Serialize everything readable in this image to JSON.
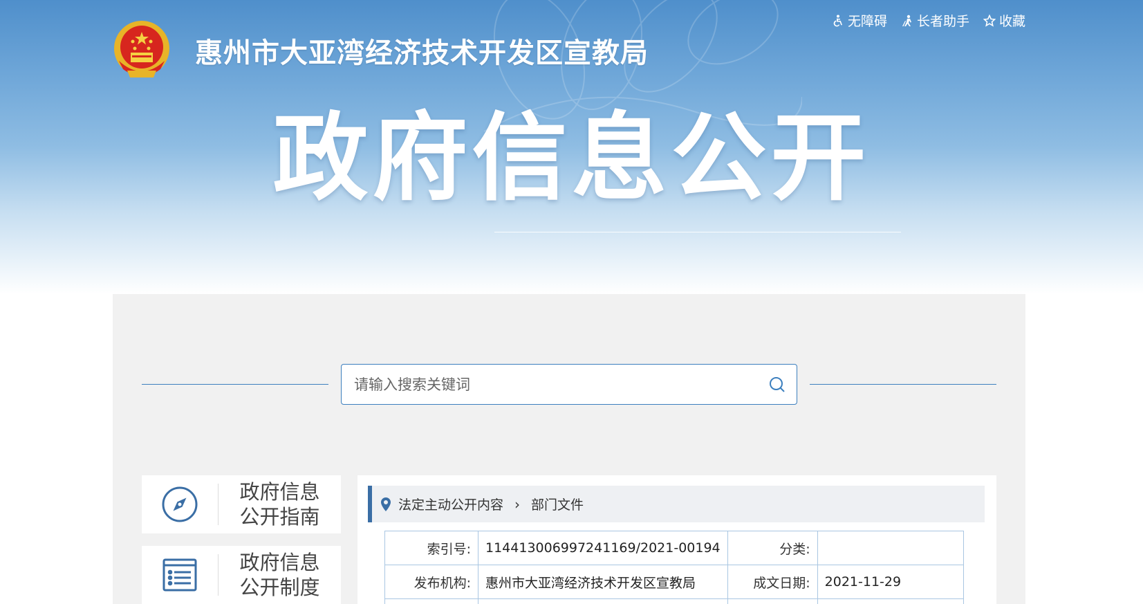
{
  "header": {
    "site_title": "惠州市大亚湾经济技术开发区宣教局",
    "hero_title": "政府信息公开",
    "toplinks": [
      {
        "label": "无障碍",
        "icon": "accessibility-icon"
      },
      {
        "label": "长者助手",
        "icon": "elderly-icon"
      },
      {
        "label": "收藏",
        "icon": "star-icon"
      }
    ]
  },
  "search": {
    "placeholder": "请输入搜索关键词"
  },
  "sidebar": {
    "items": [
      {
        "line1": "政府信息",
        "line2": "公开指南",
        "icon": "compass-icon"
      },
      {
        "line1": "政府信息",
        "line2": "公开制度",
        "icon": "list-document-icon"
      }
    ]
  },
  "breadcrumb": {
    "items": [
      "法定主动公开内容",
      "部门文件"
    ]
  },
  "meta": {
    "index_label": "索引号:",
    "index_value": "11441300699724 1169/2021-00194",
    "category_label": "分类:",
    "category_value": "",
    "publisher_label": "发布机构:",
    "publisher_value": "惠州市大亚湾经济技术开发区宣教局",
    "date_label": "成文日期:",
    "date_value": "2021-11-29"
  },
  "colors": {
    "accent": "#3c7fbe",
    "crumb_bar": "#3a6ea5",
    "panel_bg": "#f1f1f1"
  }
}
